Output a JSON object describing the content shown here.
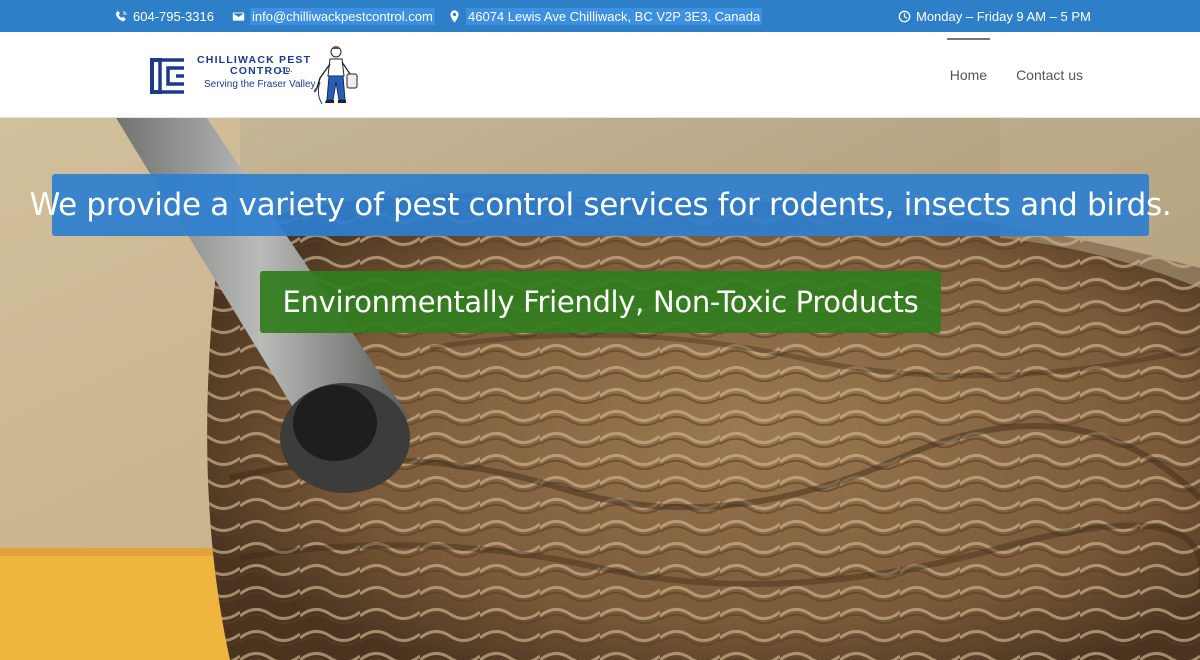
{
  "topbar": {
    "phone": "604-795-3316",
    "email": "info@chilliwackpestcontrol.com",
    "address": "46074 Lewis Ave Chilliwack, BC V2P 3E3, Canada",
    "hours": "Monday – Friday 9 AM – 5 PM",
    "icons": [
      "phone-icon",
      "envelope-icon",
      "map-pin-icon",
      "clock-icon"
    ]
  },
  "logo": {
    "name_line1": "CHILLIWACK PEST",
    "name_line2": "CONTROL",
    "suffix": "LTD.",
    "tagline": "Serving the Fraser Valley"
  },
  "nav": {
    "items": [
      {
        "label": "Home",
        "active": true
      },
      {
        "label": "Contact us",
        "active": false
      }
    ]
  },
  "hero": {
    "headline": "We provide a variety of pest control services for rodents, insects and birds.",
    "subheadline": "Environmentally Friendly, Non-Toxic Products"
  },
  "colors": {
    "topbar": "#2d7fc8",
    "banner_blue": "#2e7fcf",
    "banner_green": "#307d1e",
    "logo_navy": "#1a3b8c"
  }
}
